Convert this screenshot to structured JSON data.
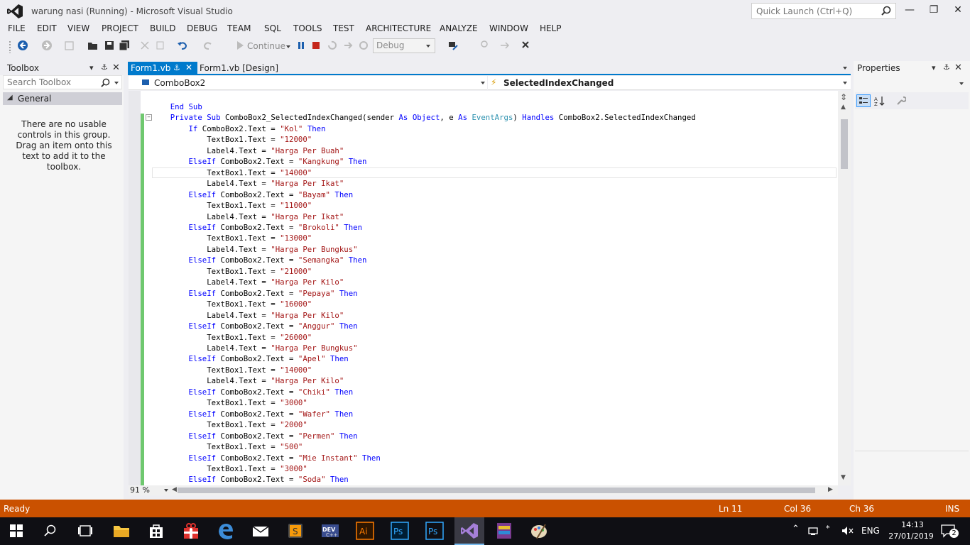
{
  "window": {
    "title": "warung nasi (Running) - Microsoft Visual Studio",
    "quick_launch_placeholder": "Quick Launch (Ctrl+Q)"
  },
  "menu": [
    "FILE",
    "EDIT",
    "VIEW",
    "PROJECT",
    "BUILD",
    "DEBUG",
    "TEAM",
    "SQL",
    "TOOLS",
    "TEST",
    "ARCHITECTURE",
    "ANALYZE",
    "WINDOW",
    "HELP"
  ],
  "toolbar": {
    "continue_label": "Continue",
    "configuration": "Debug"
  },
  "toolbox": {
    "title": "Toolbox",
    "search_placeholder": "Search Toolbox",
    "group": "General",
    "empty_message": "There are no usable controls in this group. Drag an item onto this text to add it to the toolbox."
  },
  "tabs": {
    "active": "Form1.vb",
    "design": "Form1.vb [Design]"
  },
  "navbar": {
    "object": "ComboBox2",
    "event": "SelectedIndexChanged"
  },
  "code": {
    "end_sub": "End Sub",
    "signature": "Private Sub ComboBox2_SelectedIndexChanged(sender As Object, e As EventArgs) Handles ComboBox2.SelectedIndexChanged",
    "branches": [
      {
        "kw": "If",
        "item": "Kol",
        "price": "12000",
        "label": "Harga Per Buah"
      },
      {
        "kw": "ElseIf",
        "item": "Kangkung",
        "price": "14000",
        "label": "Harga Per Ikat"
      },
      {
        "kw": "ElseIf",
        "item": "Bayam",
        "price": "11000",
        "label": "Harga Per Ikat"
      },
      {
        "kw": "ElseIf",
        "item": "Brokoli",
        "price": "13000",
        "label": "Harga Per Bungkus"
      },
      {
        "kw": "ElseIf",
        "item": "Semangka",
        "price": "21000",
        "label": "Harga Per Kilo"
      },
      {
        "kw": "ElseIf",
        "item": "Pepaya",
        "price": "16000",
        "label": "Harga Per Kilo"
      },
      {
        "kw": "ElseIf",
        "item": "Anggur",
        "price": "26000",
        "label": "Harga Per Bungkus"
      },
      {
        "kw": "ElseIf",
        "item": "Apel",
        "price": "14000",
        "label": "Harga Per Kilo"
      },
      {
        "kw": "ElseIf",
        "item": "Chiki",
        "price": "3000"
      },
      {
        "kw": "ElseIf",
        "item": "Wafer",
        "price": "2000"
      },
      {
        "kw": "ElseIf",
        "item": "Permen",
        "price": "500"
      },
      {
        "kw": "ElseIf",
        "item": "Mie Instant",
        "price": "3000"
      },
      {
        "kw": "ElseIf",
        "item": "Soda"
      }
    ],
    "zoom": "91 %"
  },
  "properties": {
    "title": "Properties"
  },
  "status": {
    "ready": "Ready",
    "line": "Ln 11",
    "col": "Col 36",
    "ch": "Ch 36",
    "mode": "INS"
  },
  "taskbar": {
    "lang": "ENG",
    "time": "14:13",
    "date": "27/01/2019",
    "notifications": "2"
  },
  "colors": {
    "accent": "#007acc",
    "status_bar": "#ca5100",
    "keyword": "#0000ff",
    "string": "#a31515",
    "type": "#2b91af"
  }
}
